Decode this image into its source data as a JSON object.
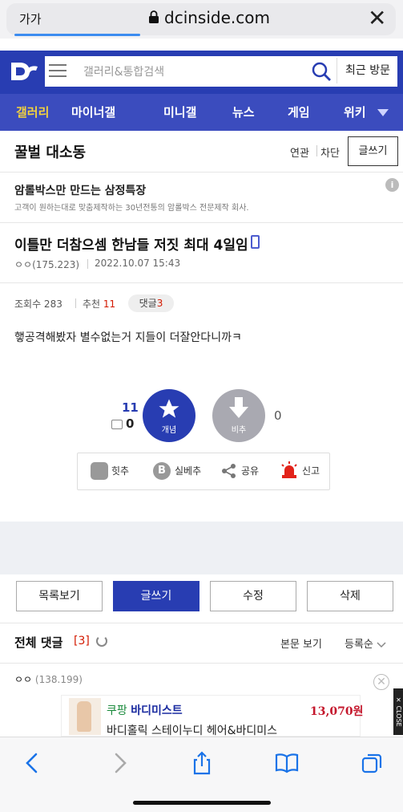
{
  "browser": {
    "aa_label": "가가",
    "url": "dcinside.com",
    "close_label": "✕"
  },
  "header": {
    "search_placeholder": "갤러리&통합검색",
    "recent_label": "최근 방문"
  },
  "nav": {
    "items": [
      "갤러리",
      "마이너갤",
      "미니갤",
      "뉴스",
      "게임",
      "위키"
    ]
  },
  "gallery": {
    "title": "꿀벌 대소동",
    "related_label": "연관",
    "block_label": "차단",
    "write_label": "글쓰기"
  },
  "ad": {
    "title": "암롤박스만 만드는 삼정특장",
    "subtitle": "고객이 원하는대로 맞춤제작하는 30년전통의 암롤박스 전문제작 회사.",
    "info_label": "i"
  },
  "post": {
    "title": "이틀만 더참으셈 한남들 저짓 최대 4일임",
    "author": "ㅇㅇ(175.223)",
    "date": "2022.10.07 15:43",
    "views_label": "조회수 283",
    "recommend_label": "추천",
    "recommend_count": "11",
    "comment_label": "댓글",
    "comment_count": "3",
    "body": "햏공격해봤자 별수없는거 지들이 더잘안다니까ㅋ"
  },
  "vote": {
    "up_count": "11",
    "fix_count": "0",
    "up_label": "개념",
    "down_label": "비추",
    "down_count": "0"
  },
  "actions": {
    "hit_label": "힛추",
    "best_label": "실베추",
    "share_label": "공유",
    "report_label": "신고"
  },
  "buttons": {
    "list": "목록보기",
    "write": "글쓰기",
    "edit": "수정",
    "delete": "삭제"
  },
  "comments": {
    "header": "전체 댓글",
    "count": "[3]",
    "view_body": "본문 보기",
    "order": "등록순",
    "first_author_name": "ㅇㅇ",
    "first_author_ip": "(138.199)"
  },
  "banner": {
    "brand_prefix": "쿠팡",
    "brand": "바디미스트",
    "price": "13,070원",
    "line2": "바디홀릭 스테이누디 헤어&바디미스",
    "side_label": "✕ CLOSE"
  },
  "colors": {
    "brand_blue": "#283db2",
    "nav_blue": "#3b4cbe",
    "highlight_yellow": "#f4d33d",
    "count_red": "#d31900"
  }
}
